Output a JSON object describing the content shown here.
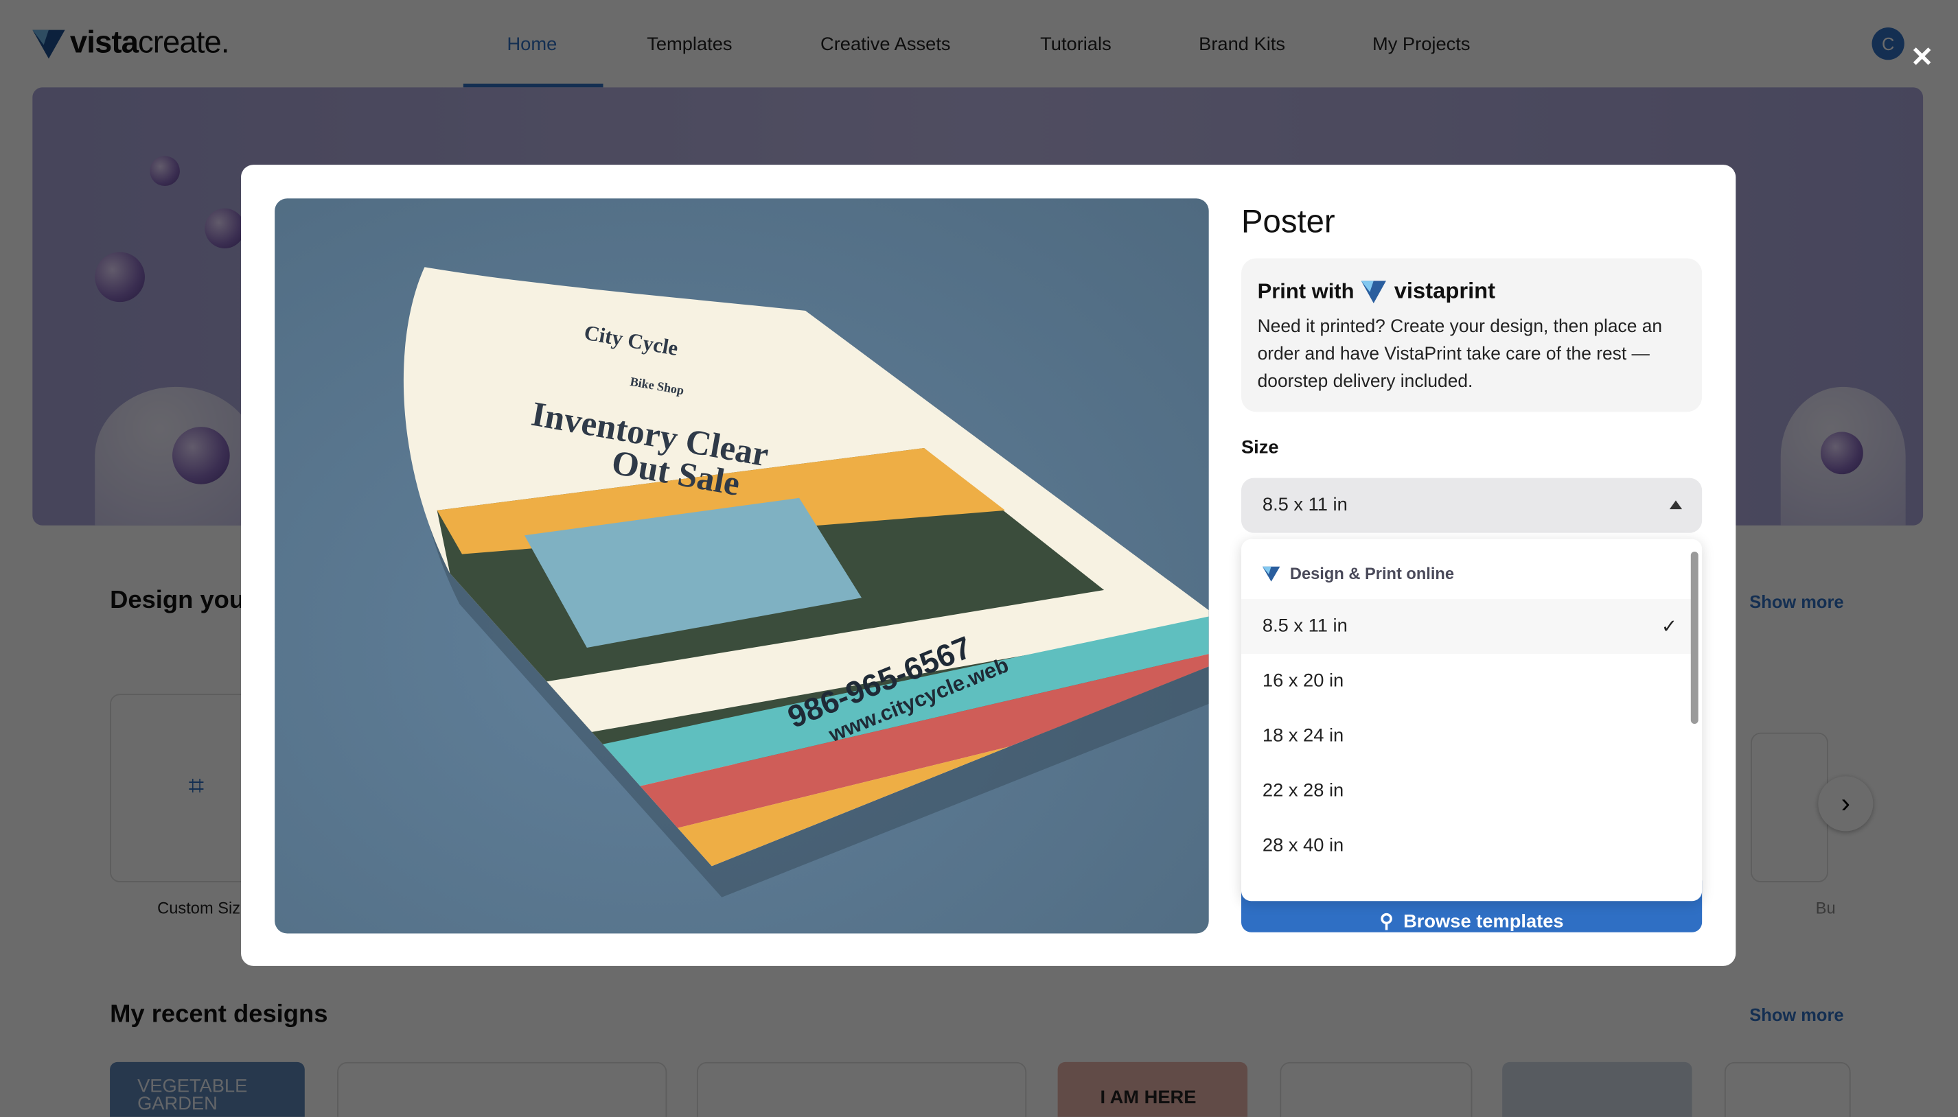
{
  "header": {
    "logo": "vistacreate",
    "nav": [
      {
        "label": "Home",
        "active": true
      },
      {
        "label": "Templates"
      },
      {
        "label": "Creative Assets"
      },
      {
        "label": "Tutorials"
      },
      {
        "label": "Brand Kits"
      },
      {
        "label": "My Projects"
      }
    ],
    "avatar_initial": "C"
  },
  "page": {
    "design_section_title": "Design you",
    "show_more": "Show more",
    "custom_size_label": "Custom Size",
    "cut_label": "Bu",
    "recent_title": "My recent designs",
    "recent_show_more": "Show more",
    "thumb1_text": "VEGETABLE GARDEN",
    "thumb2_text": "I AM HERE"
  },
  "modal": {
    "close_icon": "close-icon",
    "title": "Poster",
    "print_with": "Print with",
    "print_logo": "vistaprint",
    "print_desc": "Need it printed? Create your design, then place an order and have VistaPrint take care of the rest — doorstep delivery included.",
    "size_label": "Size",
    "selected_size": "8.5 x 11 in",
    "dropdown_header": "Design & Print online",
    "options": [
      {
        "label": "8.5 x 11 in",
        "selected": true
      },
      {
        "label": "16 x 20 in"
      },
      {
        "label": "18 x 24 in"
      },
      {
        "label": "22 x 28 in"
      },
      {
        "label": "28 x 40 in"
      }
    ],
    "browse_label": "Browse templates",
    "poster": {
      "shop": "City Cycle",
      "sub": "Bike Shop",
      "headline1": "Inventory Clear",
      "headline2": "Out Sale",
      "phone": "986-965-6567",
      "web": "www.citycycle.web"
    }
  },
  "colors": {
    "accent": "#2f6fc4",
    "teal": "#5fbfbf",
    "red": "#cf5d58",
    "yellow": "#eeae45",
    "paper": "#f7f2e2"
  }
}
